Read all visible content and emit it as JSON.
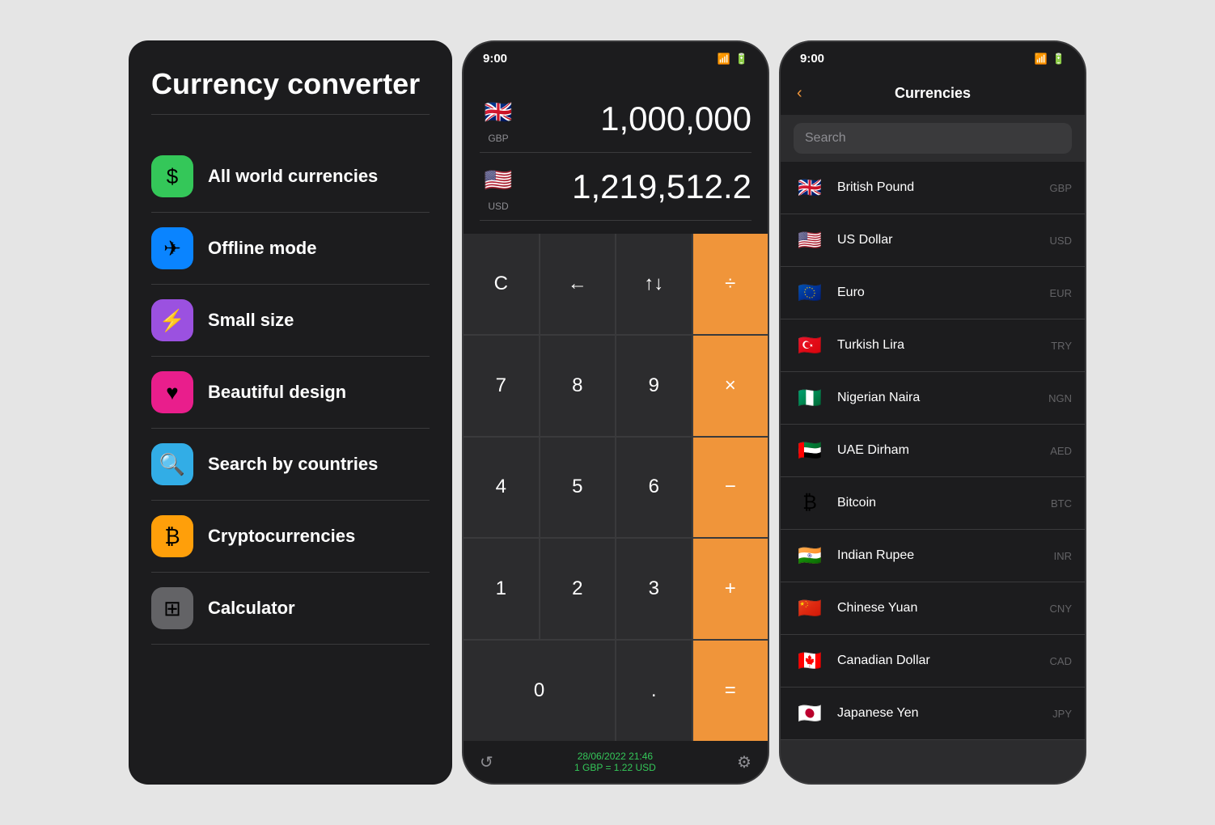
{
  "leftPanel": {
    "title": "Currency converter",
    "menuItems": [
      {
        "id": "all-currencies",
        "label": "All world currencies",
        "icon": "$",
        "iconClass": "icon-green"
      },
      {
        "id": "offline-mode",
        "label": "Offline mode",
        "icon": "✈",
        "iconClass": "icon-blue"
      },
      {
        "id": "small-size",
        "label": "Small size",
        "icon": "⚡",
        "iconClass": "icon-purple"
      },
      {
        "id": "beautiful-design",
        "label": "Beautiful design",
        "icon": "♥",
        "iconClass": "icon-pink"
      },
      {
        "id": "search-countries",
        "label": "Search by countries",
        "icon": "🔍",
        "iconClass": "icon-cyan"
      },
      {
        "id": "cryptocurrencies",
        "label": "Cryptocurrencies",
        "icon": "₿",
        "iconClass": "icon-orange"
      },
      {
        "id": "calculator",
        "label": "Calculator",
        "icon": "⊞",
        "iconClass": "icon-gray"
      }
    ]
  },
  "middlePhone": {
    "statusTime": "9:00",
    "fromCurrency": {
      "flag": "🇬🇧",
      "code": "GBP",
      "amount": "1,000,000"
    },
    "toCurrency": {
      "flag": "🇺🇸",
      "code": "USD",
      "amount": "1,219,512.2"
    },
    "buttons": {
      "clear": "C",
      "backspace": "←",
      "swap": "↑↓",
      "divide": "÷",
      "seven": "7",
      "eight": "8",
      "nine": "9",
      "multiply": "×",
      "four": "4",
      "five": "5",
      "six": "6",
      "minus": "−",
      "one": "1",
      "two": "2",
      "three": "3",
      "plus": "+",
      "zero": "0",
      "dot": ".",
      "equals": "="
    },
    "footer": {
      "date": "28/06/2022 21:46",
      "rate": "1 GBP = 1.22 USD"
    }
  },
  "rightPhone": {
    "statusTime": "9:00",
    "backLabel": "‹",
    "title": "Currencies",
    "searchPlaceholder": "Search",
    "currencies": [
      {
        "name": "British Pound",
        "code": "GBP",
        "flag": "🇬🇧"
      },
      {
        "name": "US Dollar",
        "code": "USD",
        "flag": "🇺🇸"
      },
      {
        "name": "Euro",
        "code": "EUR",
        "flag": "🇪🇺"
      },
      {
        "name": "Turkish Lira",
        "code": "TRY",
        "flag": "🇹🇷"
      },
      {
        "name": "Nigerian Naira",
        "code": "NGN",
        "flag": "🇳🇬"
      },
      {
        "name": "UAE Dirham",
        "code": "AED",
        "flag": "🇦🇪"
      },
      {
        "name": "Bitcoin",
        "code": "BTC",
        "flag": "₿"
      },
      {
        "name": "Indian Rupee",
        "code": "INR",
        "flag": "🇮🇳"
      },
      {
        "name": "Chinese Yuan",
        "code": "CNY",
        "flag": "🇨🇳"
      },
      {
        "name": "Canadian Dollar",
        "code": "CAD",
        "flag": "🇨🇦"
      },
      {
        "name": "Japanese Yen",
        "code": "JPY",
        "flag": "🇯🇵"
      }
    ]
  }
}
